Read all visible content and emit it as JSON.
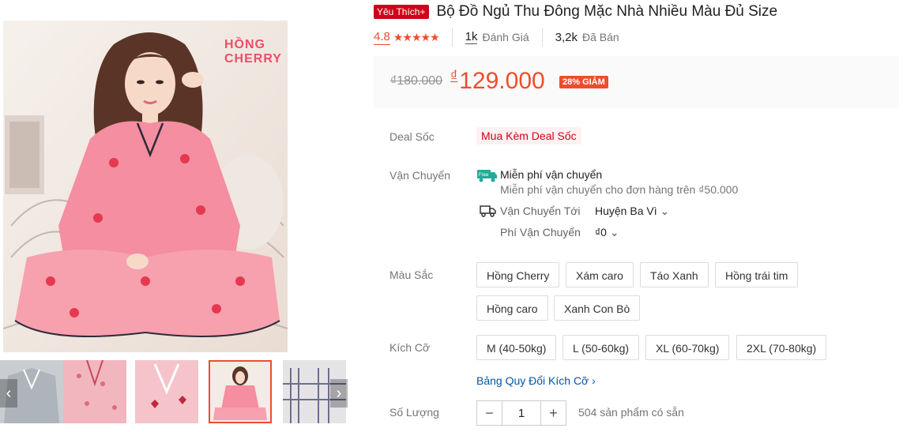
{
  "colors": {
    "accent": "#ee4d2d",
    "favorite_badge": "#d0011b",
    "link": "#0055aa",
    "pink_pajama": "#f48ea0"
  },
  "gallery": {
    "overlay_text_line1": "HỒNG",
    "overlay_text_line2": "CHERRY",
    "thumbnails": [
      "thumb-gray-pajama",
      "thumb-pink-pattern",
      "thumb-pink-hearts",
      "thumb-pink-cherry-selected",
      "thumb-plaid-pajama"
    ],
    "prev_icon": "chevron-left-icon",
    "next_icon": "chevron-right-icon"
  },
  "product": {
    "badge": "Yêu Thích+",
    "title": "Bộ Đồ Ngủ Thu Đông Mặc Nhà Nhiều Màu Đủ Size",
    "rating": "4.8",
    "star_count": 5,
    "reviews_count": "1k",
    "reviews_label": "Đánh Giá",
    "sold_count": "3,2k",
    "sold_label": "Đã Bán"
  },
  "price": {
    "old": "₫180.000",
    "currency": "₫",
    "current": "129.000",
    "discount": "28% GIẢM"
  },
  "deal": {
    "label": "Deal Sốc",
    "value": "Mua Kèm Deal Sốc"
  },
  "shipping": {
    "label": "Vận Chuyển",
    "free_icon_text": "Free",
    "free_title": "Miễn phí vận chuyển",
    "free_sub": "Miễn phí vận chuyển cho đơn hàng trên ₫50.000",
    "to_label": "Vận Chuyển Tới",
    "to_value": "Huyện Ba Vì",
    "fee_label": "Phí Vận Chuyển",
    "fee_value": "₫0"
  },
  "color_option": {
    "label": "Màu Sắc",
    "options": [
      "Hồng Cherry",
      "Xám caro",
      "Táo Xanh",
      "Hồng trái tim",
      "Hồng caro",
      "Xanh Con Bò"
    ]
  },
  "size_option": {
    "label": "Kích Cỡ",
    "options": [
      "M (40-50kg)",
      "L (50-60kg)",
      "XL (60-70kg)",
      "2XL (70-80kg)"
    ],
    "guide": "Bảng Quy Đổi Kích Cỡ"
  },
  "quantity": {
    "label": "Số Lượng",
    "minus": "−",
    "value": "1",
    "plus": "+",
    "stock": "504 sản phẩm có sẵn"
  }
}
